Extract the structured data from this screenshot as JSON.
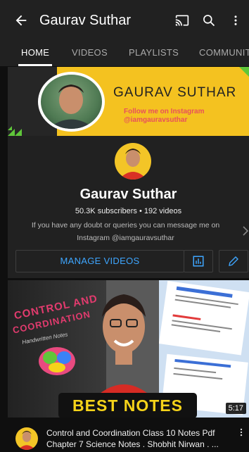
{
  "appbar": {
    "title": "Gaurav Suthar",
    "icons": [
      "back-arrow-icon",
      "cast-icon",
      "search-icon",
      "more-vert-icon"
    ]
  },
  "tabs": [
    "HOME",
    "VIDEOS",
    "PLAYLISTS",
    "COMMUNITY"
  ],
  "banner": {
    "name": "GAURAV SUTHAR",
    "follow_line1": "Follow me on Instagram",
    "follow_line2": "@iamgauravsuthar"
  },
  "channel": {
    "name": "Gaurav Suthar",
    "stats": "50.3K subscribers • 192 videos",
    "desc_line1": "If you have any doubt or queries you can message me on",
    "desc_line2": "Instagram @iamgauravsuthar",
    "manage_label": "MANAGE VIDEOS",
    "icons": [
      "analytics-icon",
      "edit-pencil-icon",
      "chevron-right-icon"
    ]
  },
  "video": {
    "thumb_title_line1": "CONTROL AND",
    "thumb_title_line2": "COORDINATION",
    "thumb_sub": "Handwritten Notes",
    "thumb_banner": "BEST NOTES",
    "duration": "5:17",
    "title_line1": "Control and Coordination Class 10 Notes Pdf",
    "title_line2": "Chapter 7 Science Notes . Shobhit Nirwan . ..."
  }
}
